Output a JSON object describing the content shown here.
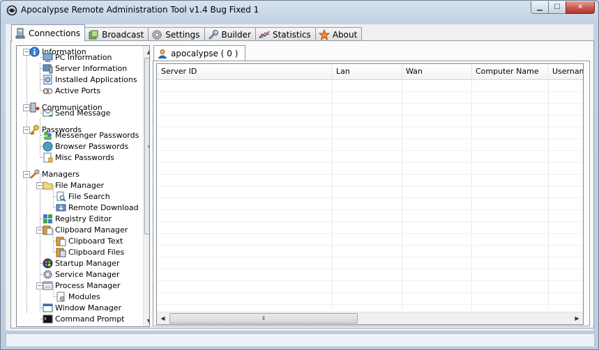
{
  "window": {
    "title": "Apocalypse Remote Administration Tool v1.4 Bug Fixed 1"
  },
  "tabs": [
    {
      "label": "Connections",
      "icon": "computer-icon"
    },
    {
      "label": "Broadcast",
      "icon": "broadcast-icon"
    },
    {
      "label": "Settings",
      "icon": "gear-icon"
    },
    {
      "label": "Builder",
      "icon": "wrench-icon"
    },
    {
      "label": "Statistics",
      "icon": "chart-icon"
    },
    {
      "label": "About",
      "icon": "star-icon"
    }
  ],
  "tree": {
    "items": [
      {
        "label": "Information",
        "icon": "info-icon"
      },
      {
        "label": "PC Information",
        "icon": "pc-icon"
      },
      {
        "label": "Server Information",
        "icon": "server-icon"
      },
      {
        "label": "Installed Applications",
        "icon": "installer-icon"
      },
      {
        "label": "Active Ports",
        "icon": "ports-icon"
      },
      {
        "label": "Communication",
        "icon": "communication-icon"
      },
      {
        "label": "Send Message",
        "icon": "message-icon"
      },
      {
        "label": "Passwords",
        "icon": "key-icon"
      },
      {
        "label": "Messenger Passwords",
        "icon": "messenger-icon"
      },
      {
        "label": "Browser Passwords",
        "icon": "globe-icon"
      },
      {
        "label": "Misc Passwords",
        "icon": "document-icon"
      },
      {
        "label": "Managers",
        "icon": "tools-icon"
      },
      {
        "label": "File Manager",
        "icon": "folder-icon"
      },
      {
        "label": "File Search",
        "icon": "search-file-icon"
      },
      {
        "label": "Remote Download",
        "icon": "download-icon"
      },
      {
        "label": "Registry Editor",
        "icon": "registry-icon"
      },
      {
        "label": "Clipboard Manager",
        "icon": "clipboard-icon"
      },
      {
        "label": "Clipboard Text",
        "icon": "clipboard-text-icon"
      },
      {
        "label": "Clipboard Files",
        "icon": "clipboard-files-icon"
      },
      {
        "label": "Startup Manager",
        "icon": "windows-logo-icon"
      },
      {
        "label": "Service Manager",
        "icon": "gear-icon"
      },
      {
        "label": "Process Manager",
        "icon": "process-icon"
      },
      {
        "label": "Modules",
        "icon": "modules-icon"
      },
      {
        "label": "Window Manager",
        "icon": "window-icon"
      },
      {
        "label": "Command Prompt",
        "icon": "console-icon"
      }
    ]
  },
  "connections": {
    "tab_label": "apocalypse ( 0 )",
    "columns": [
      "Server ID",
      "Lan",
      "Wan",
      "Computer Name",
      "Usernam"
    ]
  },
  "glyphs": {
    "minimize": "▁",
    "maximize": "☐",
    "close": "✕",
    "arrow_up": "▲",
    "arrow_down": "▼",
    "arrow_left": "◀",
    "arrow_right": "▶",
    "grip_v": "≡",
    "grip_h": "⦀",
    "collapse": "−"
  }
}
